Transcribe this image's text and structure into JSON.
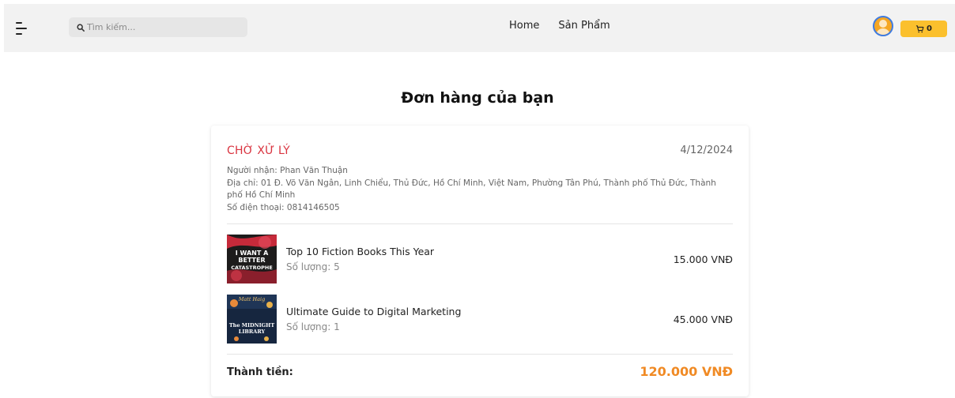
{
  "header": {
    "search_placeholder": "Tìm kiếm...",
    "nav": [
      "Home",
      "Sản Phẩm"
    ],
    "cart_count": "0",
    "accent_color": "#fbc02d"
  },
  "page": {
    "title": "Đơn hàng của bạn"
  },
  "order": {
    "status": "CHỜ XỬ LÝ",
    "status_color": "#d9333f",
    "date": "4/12/2024",
    "recipient": "Người nhận: Phan Văn Thuận",
    "address": "Địa chỉ: 01 Đ. Võ Văn Ngân, Linh Chiểu, Thủ Đức, Hồ Chí Minh, Việt Nam, Phường Tân Phú, Thành phố Thủ Đức, Thành phố Hồ Chí Minh",
    "phone": "Số điện thoại: 0814146505",
    "items": [
      {
        "name": "Top 10 Fiction Books This Year",
        "quantity": "Số lượng: 5",
        "price": "15.000 VNĐ",
        "cover_text": [
          "I WANT A",
          "BETTER",
          "CATASTROPHE"
        ]
      },
      {
        "name": "Ultimate Guide to Digital Marketing",
        "quantity": "Số lượng: 1",
        "price": "45.000 VNĐ",
        "cover_text": [
          "Matt Haig",
          "The MIDNIGHT",
          "LIBRARY"
        ]
      }
    ],
    "total_label": "Thành tiền:",
    "total_value": "120.000 VNĐ",
    "total_color": "#f08a24"
  }
}
